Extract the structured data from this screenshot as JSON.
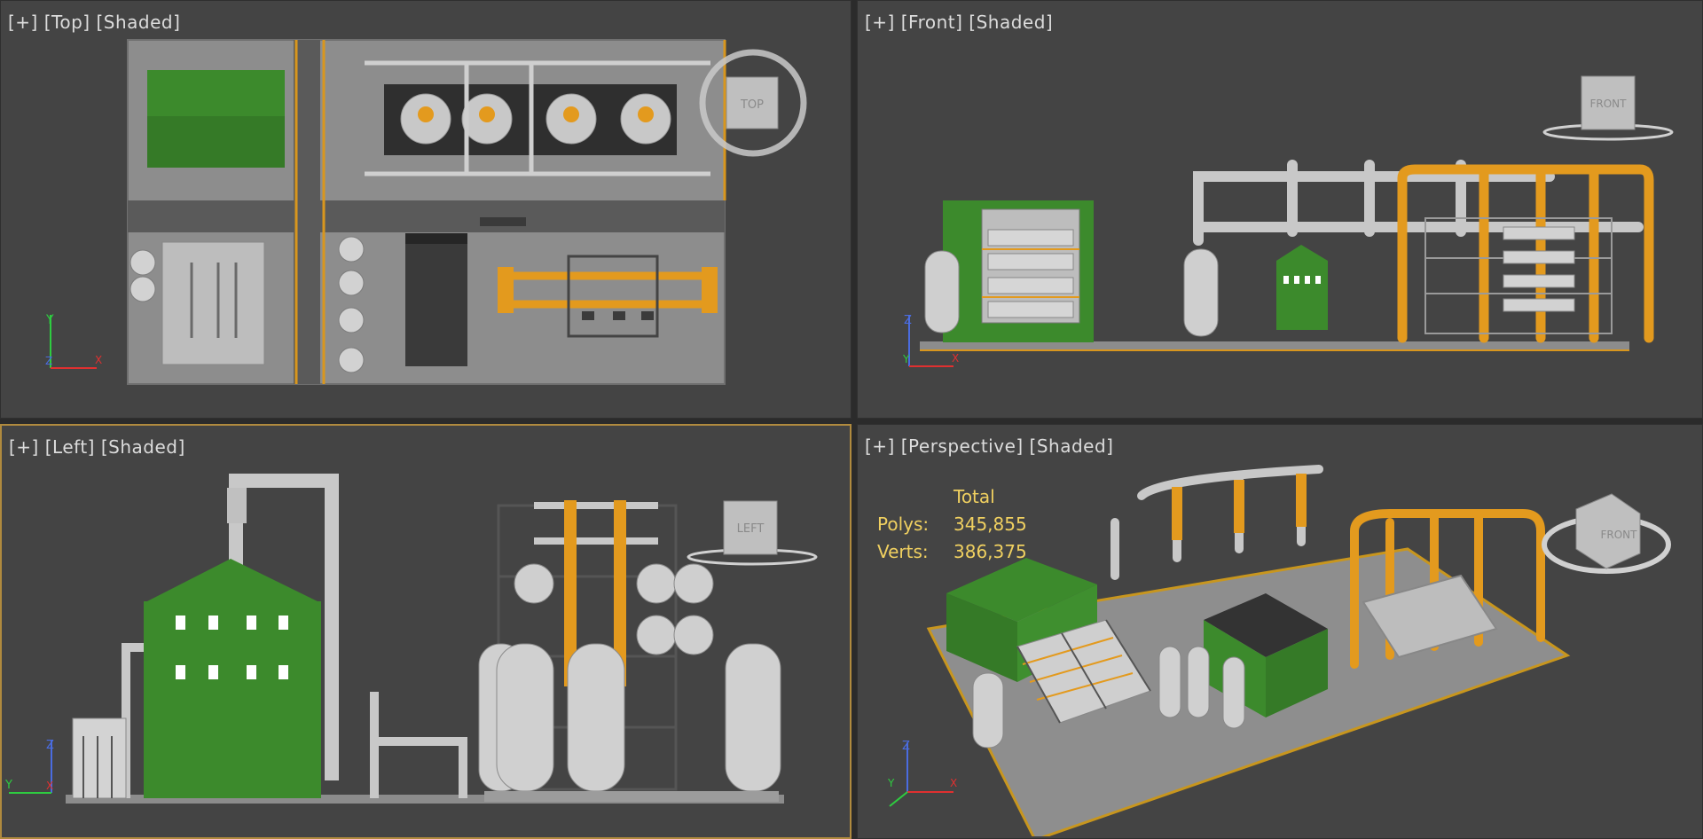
{
  "viewports": {
    "top": {
      "plus": "[+]",
      "view": "[Top]",
      "mode": "[Shaded]",
      "cube_label": "TOP"
    },
    "front": {
      "plus": "[+]",
      "view": "[Front]",
      "mode": "[Shaded]",
      "cube_label": "FRONT"
    },
    "left": {
      "plus": "[+]",
      "view": "[Left]",
      "mode": "[Shaded]",
      "cube_label": "LEFT"
    },
    "perspective": {
      "plus": "[+]",
      "view": "[Perspective]",
      "mode": "[Shaded]",
      "cube_label": "FRONT"
    }
  },
  "stats": {
    "header": "Total",
    "polys_label": "Polys:",
    "polys_value": "345,855",
    "verts_label": "Verts:",
    "verts_value": "386,375"
  },
  "axes": {
    "top": [
      "Y",
      "X",
      "Z"
    ],
    "front": [
      "Z",
      "X",
      "Y"
    ],
    "left": [
      "Z",
      "Y",
      "X"
    ],
    "perspective": [
      "Z",
      "X",
      "Y"
    ]
  },
  "colors": {
    "viewport_bg": "#444444",
    "active_border": "#b08a3e",
    "label_text": "#dcdcdc",
    "stats_text": "#f0d060",
    "pipe_orange": "#e39a1e",
    "building_green": "#3f8f2f",
    "concrete": "#9a9a9a",
    "metal": "#c8c8c8"
  }
}
